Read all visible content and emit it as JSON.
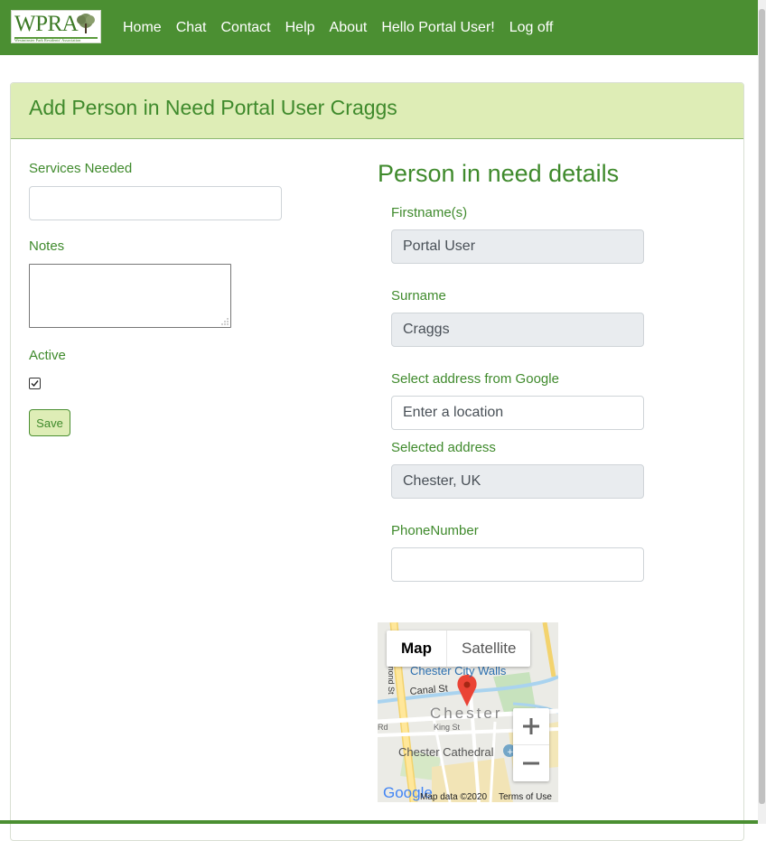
{
  "nav": {
    "logo_text": "WPRA",
    "logo_subtext": "Westminster Park Residents' Association",
    "links": [
      "Home",
      "Chat",
      "Contact",
      "Help",
      "About",
      "Hello Portal User!",
      "Log off"
    ]
  },
  "card": {
    "title": "Add Person in Need Portal User Craggs"
  },
  "form_left": {
    "services_label": "Services Needed",
    "services_value": "",
    "notes_label": "Notes",
    "notes_value": "",
    "active_label": "Active",
    "active_checked": true,
    "save_label": "Save"
  },
  "details": {
    "heading": "Person in need details",
    "firstname_label": "Firstname(s)",
    "firstname_value": "Portal User",
    "surname_label": "Surname",
    "surname_value": "Craggs",
    "google_label": "Select address from Google",
    "google_placeholder": "Enter a location",
    "selected_label": "Selected address",
    "selected_value": "Chester, UK",
    "phone_label": "PhoneNumber",
    "phone_value": ""
  },
  "map": {
    "tab_map": "Map",
    "tab_satellite": "Satellite",
    "place_walls": "Chester City Walls",
    "place_canal": "Canal St",
    "place_city": "Chester",
    "place_king": "King St",
    "place_cathedral": "Chester Cathedral",
    "place_road_left": "mond St",
    "place_rd": "Rd",
    "google_logo": "Google",
    "map_data": "Map data ©2020",
    "terms": "Terms of Use"
  },
  "colors": {
    "nav_bg": "#4b8f32",
    "header_bg": "#deedb6",
    "text_green": "#3f8a2c"
  }
}
